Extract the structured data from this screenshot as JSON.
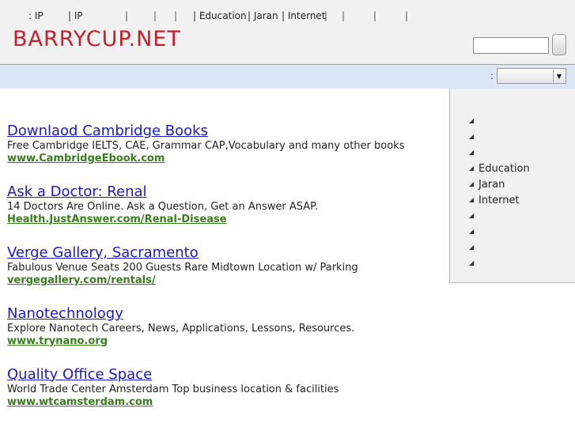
{
  "top_nav": {
    "items": [
      ": IP",
      "| IP",
      "|",
      "|",
      "|",
      "| Education",
      "| Jaran",
      "| Internet",
      "|",
      "|",
      "|",
      "|"
    ]
  },
  "header": {
    "site_title": "BARRYCUP.NET",
    "search_value": ""
  },
  "toolbar": {
    "select_label": ":",
    "select_value": ""
  },
  "ads": [
    {
      "title": "Downlaod Cambridge Books",
      "description": "Free Cambridge IELTS, CAE, Grammar CAP,Vocabulary and many other books",
      "url": "www.CambridgeEbook.com"
    },
    {
      "title": "Ask a Doctor: Renal",
      "description": "14 Doctors Are Online. Ask a Question, Get an Answer ASAP.",
      "url": "Health.JustAnswer.com/Renal-Disease"
    },
    {
      "title": "Verge Gallery, Sacramento",
      "description": "Fabulous Venue Seats 200 Guests Rare Midtown Location w/ Parking",
      "url": "vergegallery.com/rentals/"
    },
    {
      "title": "Nanotechnology",
      "description": "Explore Nanotech Careers, News, Applications, Lessons, Resources.",
      "url": "www.trynano.org"
    },
    {
      "title": "Quality Office Space",
      "description": "World Trade Center Amsterdam Top business location & facilities",
      "url": "www.wtcamsterdam.com"
    }
  ],
  "sidebar": {
    "items": [
      "",
      "",
      "",
      "Education",
      "Jaran",
      "Internet",
      "",
      "",
      "",
      ""
    ]
  },
  "colors": {
    "site_title": "#c4202a",
    "ad_title": "#1a1ac8",
    "ad_url": "#3a7d1e",
    "bluebar": "#dce6f4"
  }
}
